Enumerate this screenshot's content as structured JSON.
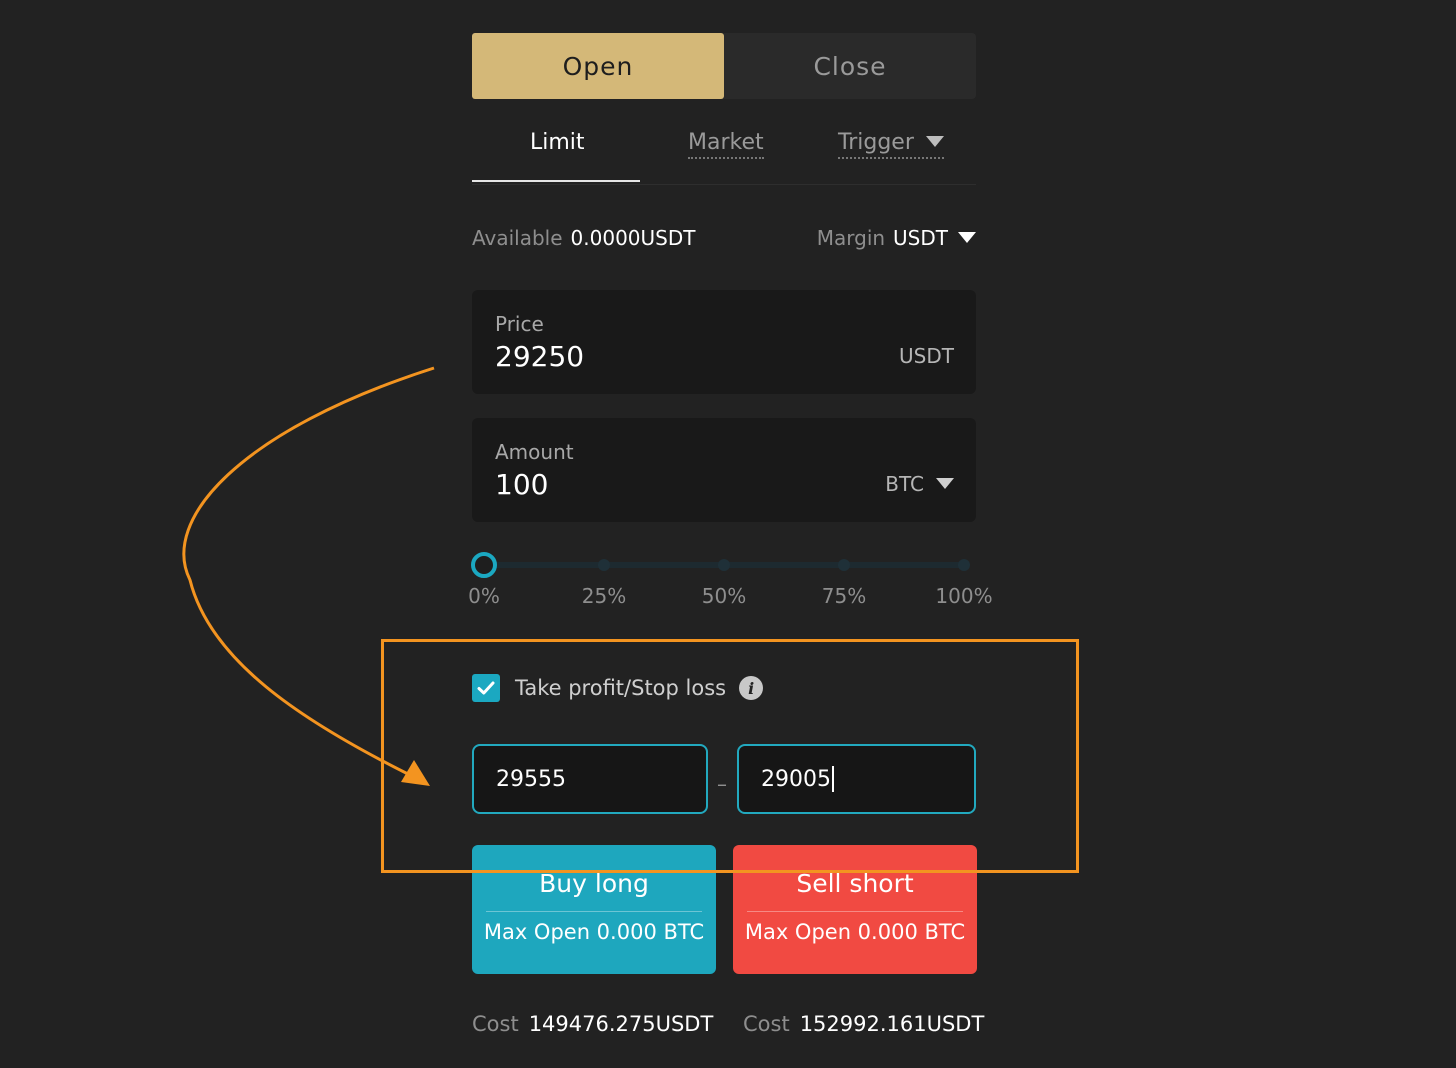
{
  "mode_toggle": {
    "open_label": "Open",
    "close_label": "Close"
  },
  "order_tabs": {
    "limit": "Limit",
    "market": "Market",
    "trigger": "Trigger"
  },
  "balance": {
    "available_label": "Available",
    "available_value": "0.0000USDT",
    "margin_label": "Margin",
    "margin_value": "USDT"
  },
  "price_field": {
    "label": "Price",
    "value": "29250",
    "unit": "USDT"
  },
  "amount_field": {
    "label": "Amount",
    "value": "100",
    "unit": "BTC"
  },
  "slider": {
    "value_percent": 0,
    "marks": [
      "0%",
      "25%",
      "50%",
      "75%",
      "100%"
    ]
  },
  "tpsl": {
    "checked": true,
    "label": "Take profit/Stop loss",
    "take_profit_value": "29555",
    "stop_loss_value": "29005",
    "separator": "–"
  },
  "buy_button": {
    "title": "Buy long",
    "subtitle": "Max Open 0.000 BTC"
  },
  "sell_button": {
    "title": "Sell short",
    "subtitle": "Max Open 0.000 BTC"
  },
  "costs": {
    "buy_label": "Cost",
    "buy_value": "149476.275USDT",
    "sell_label": "Cost",
    "sell_value": "152992.161USDT"
  },
  "colors": {
    "background": "#222222",
    "open_active": "#d4b878",
    "accent_teal": "#1ba8c1",
    "buy": "#1ea7be",
    "sell": "#f14a42",
    "annotation_orange": "#f39420"
  }
}
